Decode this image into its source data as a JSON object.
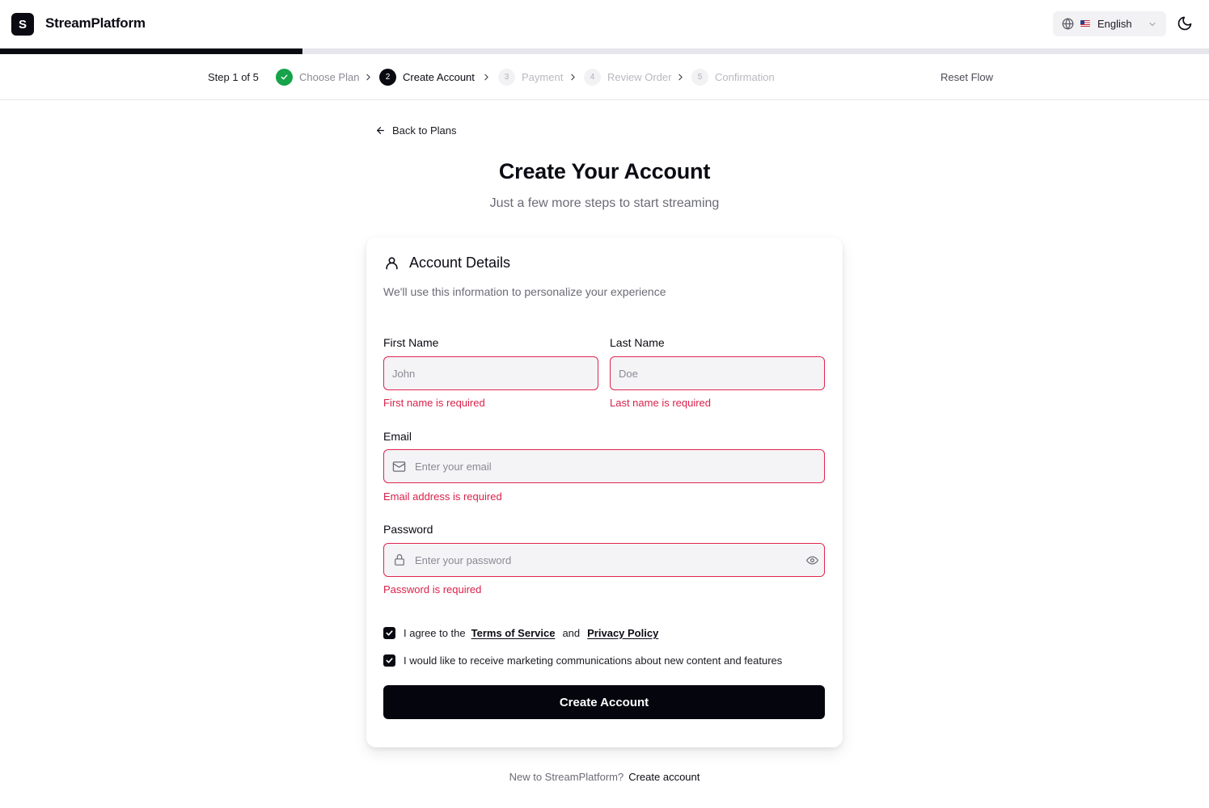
{
  "header": {
    "logo_letter": "S",
    "brand": "StreamPlatform",
    "language": "English"
  },
  "progress": {
    "fraction": 0.25
  },
  "stepper": {
    "count_text": "Step 1 of 5",
    "steps": [
      {
        "number": "1",
        "label": "Choose Plan",
        "state": "done"
      },
      {
        "number": "2",
        "label": "Create Account",
        "state": "active"
      },
      {
        "number": "3",
        "label": "Payment",
        "state": "todo"
      },
      {
        "number": "4",
        "label": "Review Order",
        "state": "todo"
      },
      {
        "number": "5",
        "label": "Confirmation",
        "state": "todo"
      }
    ],
    "reset_label": "Reset Flow"
  },
  "page": {
    "back_label": "Back to Plans",
    "title": "Create Your Account",
    "subtitle": "Just a few more steps to start streaming"
  },
  "form": {
    "card_title": "Account Details",
    "card_description": "We'll use this information to personalize your experience",
    "first_name": {
      "label": "First Name",
      "placeholder": "John",
      "value": "",
      "error": "First name is required"
    },
    "last_name": {
      "label": "Last Name",
      "placeholder": "Doe",
      "value": "",
      "error": "Last name is required"
    },
    "email": {
      "label": "Email",
      "placeholder": "Enter your email",
      "value": "",
      "error": "Email address is required"
    },
    "password": {
      "label": "Password",
      "placeholder": "Enter your password",
      "value": "",
      "error": "Password is required"
    },
    "terms": {
      "checked": true,
      "prefix": "I agree to the",
      "terms_link": "Terms of Service",
      "and": "and",
      "privacy_link": "Privacy Policy"
    },
    "marketing": {
      "checked": true,
      "text": "I would like to receive marketing communications about new content and features"
    },
    "submit_label": "Create Account"
  },
  "footer": {
    "prompt": "New to StreamPlatform?",
    "link": "Create account"
  },
  "colors": {
    "primary": "#0a0a12",
    "error": "#d9214a",
    "success": "#16a34a",
    "muted": "#6b6b76"
  },
  "icons": [
    "globe-icon",
    "chevron-down-icon",
    "moon-icon",
    "check-icon",
    "chevron-right-icon",
    "arrow-left-icon",
    "user-icon",
    "mail-icon",
    "lock-icon",
    "eye-icon"
  ]
}
